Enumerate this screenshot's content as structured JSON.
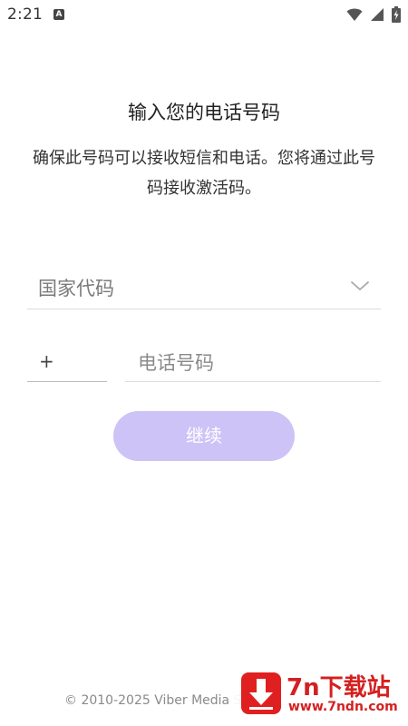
{
  "status_bar": {
    "time": "2:21",
    "notification_icon_letter": "A",
    "icons": [
      "wifi-icon",
      "cell-signal-icon",
      "battery-charging-icon"
    ]
  },
  "header": {
    "title": "输入您的电话号码",
    "description": "确保此号码可以接收短信和电话。您将通过此号码接收激活码。"
  },
  "form": {
    "country_code_placeholder": "国家代码",
    "prefix": "+",
    "phone_placeholder": "电话号码",
    "continue_label": "继续"
  },
  "footer": {
    "copyright": "© 2010-2025 Viber Media S"
  },
  "watermark": {
    "title": "7n下载站",
    "url": "www.7ndn.com"
  },
  "colors": {
    "button_disabled": "#cdc3f6",
    "watermark_red": "#d42020"
  }
}
